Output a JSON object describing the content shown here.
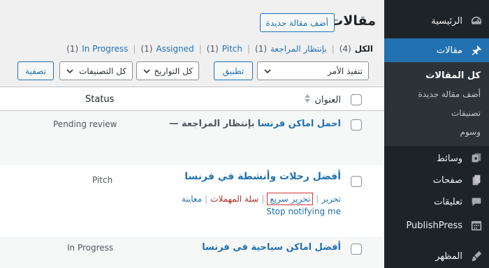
{
  "sidebar": {
    "items": [
      {
        "label": "الرئيسية",
        "icon": "dashboard-icon"
      },
      {
        "label": "مقالات",
        "icon": "pin-icon",
        "active": true
      },
      {
        "label": "وسائط",
        "icon": "media-icon"
      },
      {
        "label": "صفحات",
        "icon": "pages-icon"
      },
      {
        "label": "تعليقات",
        "icon": "comments-icon"
      },
      {
        "label": "PublishPress",
        "icon": "calendar-icon"
      },
      {
        "label": "المظهر",
        "icon": "appearance-icon"
      }
    ],
    "submenu": [
      {
        "label": "كل المقالات",
        "current": true
      },
      {
        "label": "أضف مقالة جديدة"
      },
      {
        "label": "تصنيفات"
      },
      {
        "label": "وسوم"
      }
    ]
  },
  "header": {
    "title": "مقالات",
    "add_new_label": "أضف مقالة جديدة"
  },
  "views": [
    {
      "label": "الكل",
      "count": "(4)",
      "current": true
    },
    {
      "label": "بإنتظار المراجعة",
      "count": "(1)"
    },
    {
      "label": "Pitch",
      "count": "(1)"
    },
    {
      "label": "Assigned",
      "count": "(1)"
    },
    {
      "label": "In Progress",
      "count": "(1)"
    }
  ],
  "toolbar": {
    "bulk_action": "تنفيذ الأمر",
    "apply_label": "تطبيق",
    "dates_filter": "كل التواريخ",
    "categories_filter": "كل التصنيفات",
    "filter_label": "تصفية"
  },
  "table": {
    "col_title": "العنوان",
    "col_status": "Status",
    "rows": [
      {
        "title": "احمل اماكن فرنسا",
        "state": "— بإنتظار المراجعة",
        "status": "Pending review"
      },
      {
        "title": "أفضل رحلات وأنشطة في فرنسا",
        "status": "Pitch",
        "actions": {
          "edit": "تحرير",
          "quick_edit": "تحرير سريع",
          "trash": "سلة المهملات",
          "preview": "معاينة",
          "stop_notify": "Stop notifying me"
        }
      },
      {
        "title": "أفضل اماكن سياحية في فرنسا",
        "status": "In Progress"
      }
    ]
  },
  "colors": {
    "accent": "#2271b1",
    "sidebar_bg": "#1d2327",
    "danger": "#b32d2e"
  }
}
